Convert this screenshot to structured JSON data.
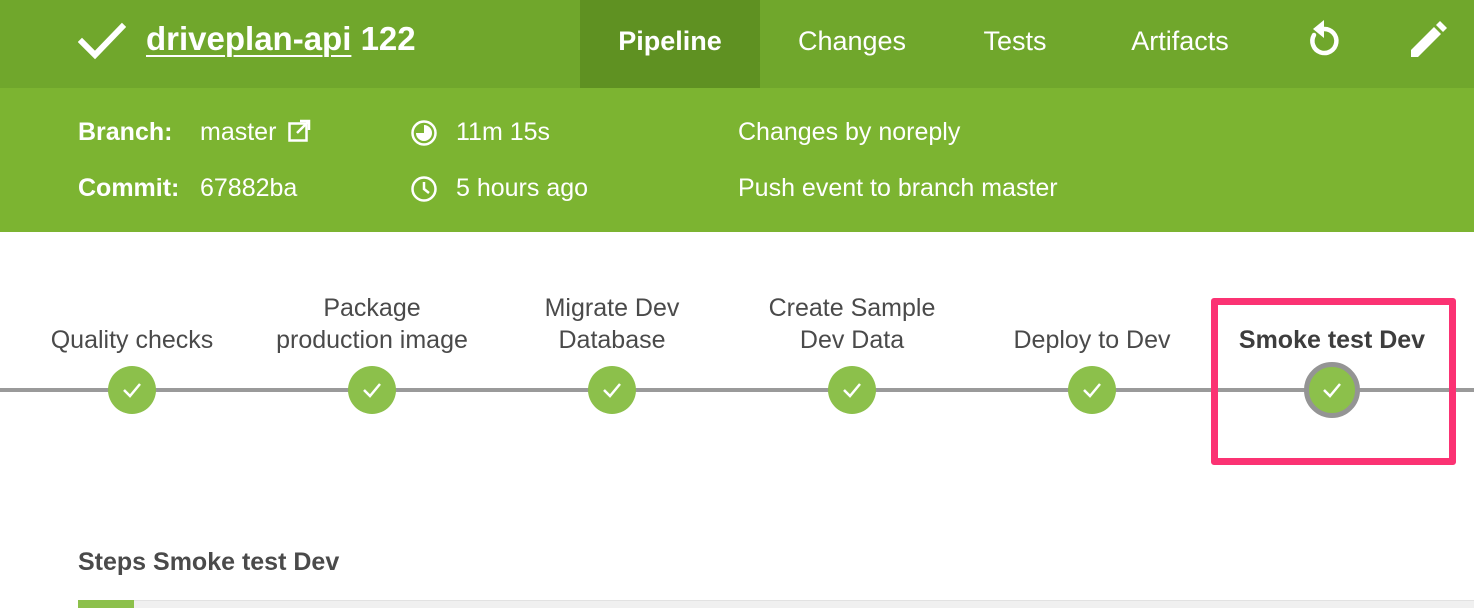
{
  "header": {
    "status_icon": "check-icon",
    "pipeline_name": "driveplan-api",
    "run_number": "122",
    "tabs": [
      {
        "label": "Pipeline",
        "active": true
      },
      {
        "label": "Changes",
        "active": false
      },
      {
        "label": "Tests",
        "active": false
      },
      {
        "label": "Artifacts",
        "active": false
      }
    ],
    "actions": [
      "replay-icon",
      "edit-icon"
    ]
  },
  "info": {
    "branch_label": "Branch:",
    "branch_value": "master",
    "commit_label": "Commit:",
    "commit_value": "67882ba",
    "duration": "11m 15s",
    "started": "5 hours ago",
    "changes_by": "Changes by noreply",
    "cause": "Push event to branch master"
  },
  "stages": [
    {
      "line1": "",
      "line2": "Quality checks",
      "status": "success"
    },
    {
      "line1": "Package",
      "line2": "production image",
      "status": "success"
    },
    {
      "line1": "Migrate Dev",
      "line2": "Database",
      "status": "success"
    },
    {
      "line1": "Create Sample",
      "line2": "Dev Data",
      "status": "success"
    },
    {
      "line1": "",
      "line2": "Deploy to Dev",
      "status": "success"
    },
    {
      "line1": "",
      "line2": "Smoke test Dev",
      "status": "success",
      "selected": true
    }
  ],
  "steps": {
    "title": "Steps Smoke test Dev"
  },
  "colors": {
    "header": "#70a72c",
    "active_tab": "#5f9122",
    "info_band": "#7cb431",
    "success": "#8cc04b",
    "highlight": "#fb3273"
  }
}
